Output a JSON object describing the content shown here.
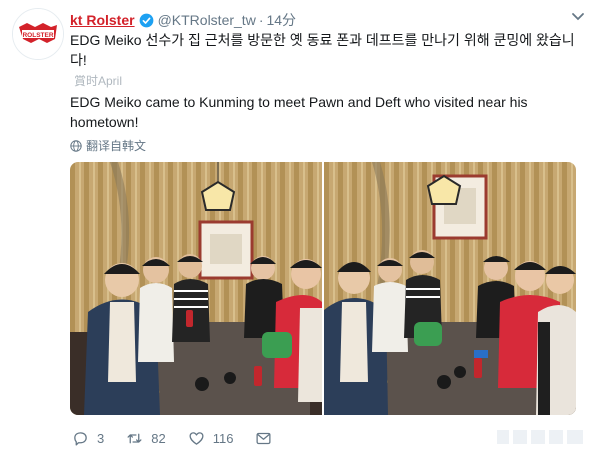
{
  "tweet": {
    "display_name": "kt Rolster",
    "handle": "@KTRolster_tw",
    "separator": "·",
    "time": "14分",
    "avatar_text": "ROLSTER",
    "text_korean": "EDG Meiko 선수가 집 근처를 방문한 옛 동료 폰과 데프트를 만나기 위해 쿤밍에 왔습니다!",
    "translated_from": "翻譯自韓文",
    "translated_label": "賞时April",
    "text_english": "EDG Meiko came to Kunming to meet Pawn and Deft who visited near his hometown!",
    "translate_link": "翻译自韩文"
  },
  "actions": {
    "reply_count": "3",
    "retweet_count": "82",
    "like_count": "116"
  },
  "colors": {
    "brand_red": "#d3222a",
    "verified_blue": "#1da1f2",
    "muted": "#657786",
    "retweet_green": "#17bf63"
  },
  "icons": [
    "verified-icon",
    "caret-down-icon",
    "globe-icon",
    "reply-icon",
    "retweet-icon",
    "like-icon",
    "mail-icon"
  ]
}
